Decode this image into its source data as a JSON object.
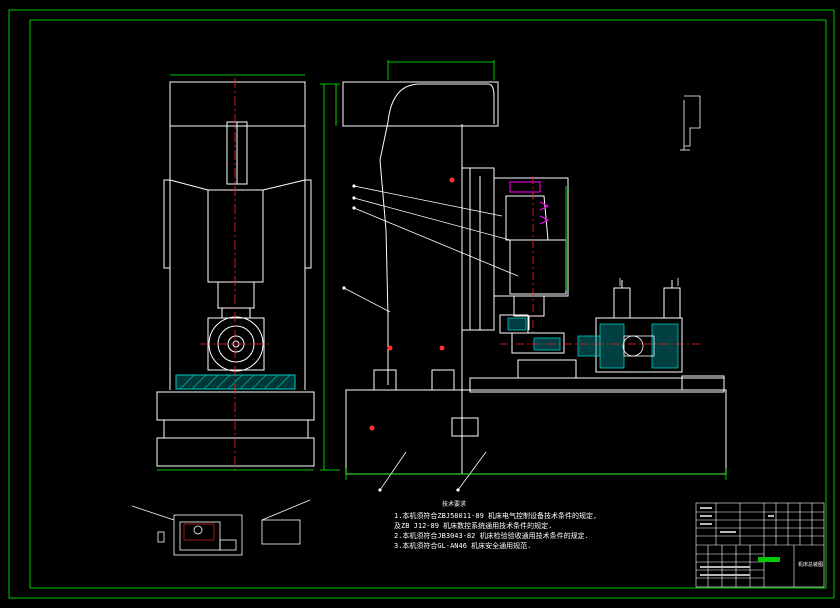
{
  "drawing": {
    "background": "#000000",
    "frame_color": "#00c800",
    "line_color": "#ffffff",
    "centerline_color": "#ff2020",
    "dimension_color": "#00ff00",
    "section_color": "#00c8c8",
    "highlight_color": "#ff00ff"
  },
  "notes": {
    "title": "技术要求",
    "lines": [
      "1.本机须符合ZBJ58011-89 机床电气控制设备技术条件的规定,",
      "  及ZB J12-89 机床数控系统通用技术条件的规定.",
      "2.本机须符合JB3043-82 机床检验验收通用技术条件的规定.",
      "3.本机须符合GL-AN46 机床安全通用规范."
    ]
  },
  "title_block": {
    "drawing_name": "机床总装图"
  }
}
